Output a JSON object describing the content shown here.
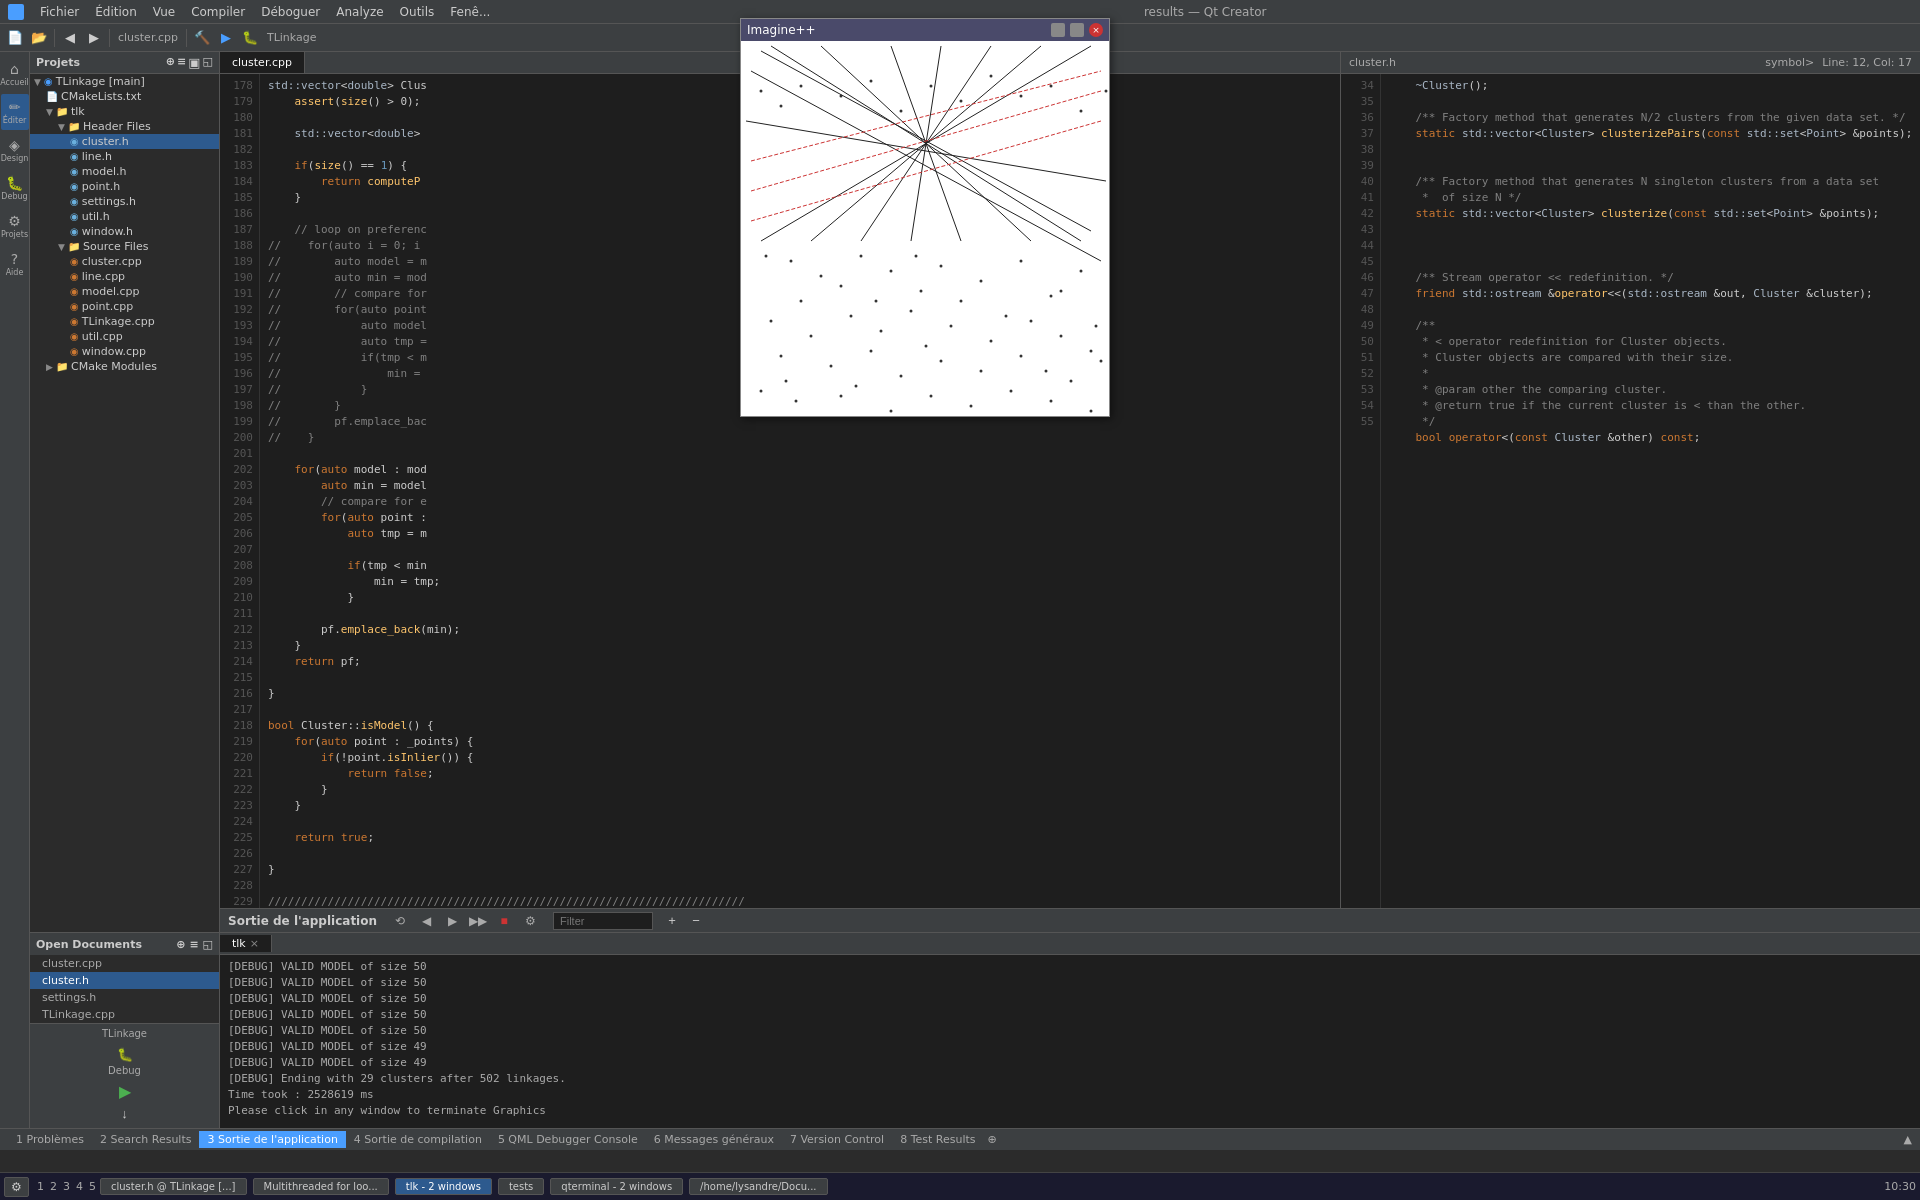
{
  "app": {
    "title": "results",
    "qt_title": "Qt Creator"
  },
  "menubar": {
    "items": [
      "Fichier",
      "Édition",
      "Vue",
      "Compiler",
      "Déboguer",
      "Analyse",
      "Outils",
      "Fenê..."
    ]
  },
  "toolbar": {
    "project_label": "TLinkage",
    "build_label": "Debug"
  },
  "filetree": {
    "title": "Projets",
    "items": [
      {
        "id": "tlinkage-main",
        "label": "TLinkage [main]",
        "indent": 0,
        "type": "project",
        "expanded": true
      },
      {
        "id": "cmakelists",
        "label": "CMakeLists.txt",
        "indent": 1,
        "type": "file"
      },
      {
        "id": "tlk",
        "label": "tlk",
        "indent": 1,
        "type": "folder",
        "expanded": true
      },
      {
        "id": "header-files",
        "label": "Header Files",
        "indent": 2,
        "type": "folder",
        "expanded": true
      },
      {
        "id": "cluster-h",
        "label": "cluster.h",
        "indent": 3,
        "type": "h-file",
        "selected": true
      },
      {
        "id": "line-h",
        "label": "line.h",
        "indent": 3,
        "type": "h-file"
      },
      {
        "id": "model-h",
        "label": "model.h",
        "indent": 3,
        "type": "h-file"
      },
      {
        "id": "point-h",
        "label": "point.h",
        "indent": 3,
        "type": "h-file"
      },
      {
        "id": "settings-h",
        "label": "settings.h",
        "indent": 3,
        "type": "h-file"
      },
      {
        "id": "util-h",
        "label": "util.h",
        "indent": 3,
        "type": "h-file"
      },
      {
        "id": "window-h",
        "label": "window.h",
        "indent": 3,
        "type": "h-file"
      },
      {
        "id": "source-files",
        "label": "Source Files",
        "indent": 2,
        "type": "folder",
        "expanded": true
      },
      {
        "id": "cluster-cpp",
        "label": "cluster.cpp",
        "indent": 3,
        "type": "cpp-file"
      },
      {
        "id": "line-cpp",
        "label": "line.cpp",
        "indent": 3,
        "type": "cpp-file"
      },
      {
        "id": "model-cpp",
        "label": "model.cpp",
        "indent": 3,
        "type": "cpp-file"
      },
      {
        "id": "point-cpp",
        "label": "point.cpp",
        "indent": 3,
        "type": "cpp-file"
      },
      {
        "id": "tlinkage-cpp",
        "label": "TLinkage.cpp",
        "indent": 3,
        "type": "cpp-file"
      },
      {
        "id": "util-cpp",
        "label": "util.cpp",
        "indent": 3,
        "type": "cpp-file"
      },
      {
        "id": "window-cpp",
        "label": "window.cpp",
        "indent": 3,
        "type": "cpp-file"
      },
      {
        "id": "cmake-modules",
        "label": "CMake Modules",
        "indent": 1,
        "type": "folder"
      }
    ]
  },
  "open_documents": {
    "title": "Open Documents",
    "items": [
      {
        "label": "cluster.cpp"
      },
      {
        "label": "cluster.h",
        "active": true
      },
      {
        "label": "settings.h"
      },
      {
        "label": "TLinkage.cpp"
      }
    ]
  },
  "editor": {
    "tab": "cluster.cpp",
    "line_start": 178,
    "lines": [
      "std::vector<double> Clus",
      "    assert(size() > 0);",
      "",
      "    std::vector<double>",
      "",
      "    if(size() == 1) {",
      "        return computeP",
      "    }",
      "",
      "    // loop on preferenc",
      "//    for(auto i = 0; i",
      "//        auto model = m",
      "//        auto min = mod",
      "//        // compare for",
      "//        for(auto point",
      "//            auto model",
      "//            auto tmp =",
      "//            if(tmp < m",
      "//                min =",
      "//            }",
      "//        }",
      "//        pf.emplace_bac",
      "//    }",
      "",
      "    for(auto model : mod",
      "        auto min = model",
      "        // compare for e",
      "        for(auto point :",
      "            auto tmp = m",
      "",
      "            if(tmp < min",
      "                min = tmp;",
      "            }",
      "",
      "        pf.emplace_back(min);",
      "    }",
      "    return pf;",
      "",
      "}",
      "",
      "bool Cluster::isModel() {",
      "    for(auto point : _points) {",
      "        if(!point.isInlier()) {",
      "            return false;",
      "        }",
      "    }",
      "",
      "    return true;",
      "",
      "}",
      "",
      "////////////////////////////////////////////////////////////////////////",
      "",
      "",
      ""
    ]
  },
  "right_panel": {
    "header": "cluster.h",
    "location_bar": "symbol>",
    "line_col": "Line: 12, Col: 17",
    "line_start": 34,
    "lines": [
      "    ~Cluster();",
      "",
      "    /** Factory method that generates N/2 clusters from the given data set. */",
      "    static std::vector<Cluster> clusterizePairs(const std::set<Point> &points);",
      "",
      "",
      "    /** Factory method that generates N singleton clusters from a data set",
      "     *  of size N */",
      "    static std::vector<Cluster> clusterize(const std::set<Point> &points);",
      "",
      "",
      "",
      "    /** Stream operator << redefinition. */",
      "    friend std::ostream &operator<<(std::ostream &out, Cluster &cluster);",
      "",
      "    /**",
      "     * < operator redefinition for Cluster objects.",
      "     * Cluster objects are compared with their size.",
      "     *",
      "     * @param other the comparing cluster.",
      "     * @return true if the current cluster is < than the other.",
      "     */",
      "    bool operator<(const Cluster &other) const;"
    ]
  },
  "bottom_panel": {
    "tabs": [
      "1 Problèmes",
      "2 Search Results",
      "3 Sortie de l'application",
      "4 Sortie de compilation",
      "5 QML Debugger Console",
      "6 Messages généraux",
      "7 Version Control",
      "8 Test Results"
    ],
    "active_tab": "3 Sortie de l'application",
    "filter_placeholder": "Filter",
    "subtab": "tlk",
    "output_lines": [
      "[DEBUG] VALID MODEL of size 50",
      "[DEBUG] VALID MODEL of size 50",
      "[DEBUG] VALID MODEL of size 50",
      "[DEBUG] VALID MODEL of size 50",
      "[DEBUG] VALID MODEL of size 50",
      "[DEBUG] VALID MODEL of size 49",
      "[DEBUG] VALID MODEL of size 49",
      "[DEBUG] Ending with 29 clusters after 502 linkages.",
      "Time took : 2528619 ms",
      "Please click in any window to terminate Graphics"
    ]
  },
  "imagine_window": {
    "title": "Imagine++",
    "buttons": [
      "_",
      "□",
      "×"
    ]
  },
  "statusbar": {
    "tabs": [
      {
        "label": "1 Problèmes"
      },
      {
        "label": "2 Search Results"
      },
      {
        "label": "3 Sortie de l'application",
        "active": true
      },
      {
        "label": "4 Sortie de compilation"
      },
      {
        "label": "5 QML Debugger Console"
      },
      {
        "label": "6 Messages généraux"
      },
      {
        "label": "7 Version Control"
      },
      {
        "label": "8 Test Results"
      }
    ]
  },
  "taskbar": {
    "items": [
      {
        "label": "🔧",
        "type": "icon"
      },
      {
        "label": "1"
      },
      {
        "label": "2"
      },
      {
        "label": "3"
      },
      {
        "label": "4"
      },
      {
        "label": "5"
      },
      {
        "label": "cluster.h @ TLinkage [...]"
      },
      {
        "label": "Multithreaded for loo..."
      },
      {
        "label": "tlk - 2 windows"
      },
      {
        "label": "tests"
      },
      {
        "label": "qterminal - 2 windows"
      },
      {
        "label": "/home/lysandre/Docu..."
      }
    ],
    "time": "10:30"
  },
  "icons": {
    "project": "📁",
    "folder_open": "▼",
    "folder_closed": "▶",
    "h_file": "🔵",
    "cpp_file": "🟡",
    "cmake_file": "📄"
  }
}
